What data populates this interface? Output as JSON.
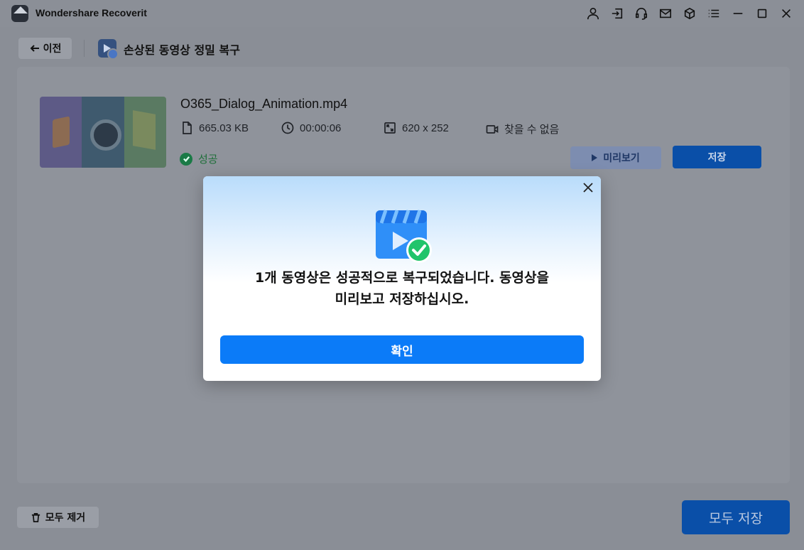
{
  "app": {
    "title": "Wondershare Recoverit"
  },
  "titlebar": {
    "icons": [
      "user-icon",
      "sign-in-icon",
      "headset-icon",
      "mail-icon",
      "cube-icon",
      "menu-icon",
      "minimize-icon",
      "maximize-icon",
      "close-icon"
    ]
  },
  "header": {
    "back_label": "이전",
    "page_title": "손상된 동영상 정밀 복구"
  },
  "file": {
    "name": "O365_Dialog_Animation.mp4",
    "size": "665.03   KB",
    "duration": "00:00:06",
    "resolution": "620 x 252",
    "camera": "찾을 수 없음",
    "status": "성공"
  },
  "actions": {
    "preview_label": "미리보기",
    "save_label": "저장",
    "remove_all_label": "모두 제거",
    "save_all_label": "모두 저장"
  },
  "dialog": {
    "message_line1": "1개 동영상은 성공적으로 복구되었습니다. 동영상을",
    "message_line2": "미리보고 저장하십시오.",
    "ok_label": "확인"
  },
  "colors": {
    "accent": "#0b7bf8",
    "success": "#27ae60",
    "overlay_bg": "#8a8e96"
  }
}
